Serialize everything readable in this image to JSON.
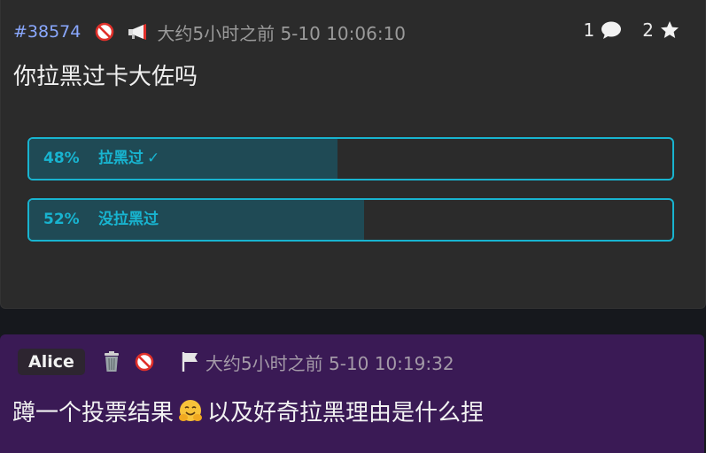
{
  "post": {
    "id": "#38574",
    "timestamp": "大约5小时之前 5-10 10:06:10",
    "comment_count": "1",
    "star_count": "2",
    "title": "你拉黑过卡大佐吗",
    "poll": [
      {
        "percent_label": "48%",
        "label": "拉黑过",
        "check": "✓",
        "fraction": 0.48
      },
      {
        "percent_label": "52%",
        "label": "没拉黑过",
        "check": "",
        "fraction": 0.52
      }
    ]
  },
  "reply": {
    "author": "Alice",
    "timestamp": "大约5小时之前 5-10 10:19:32",
    "text_before": "蹲一个投票结果",
    "text_after": "以及好奇拉黑理由是什么捏"
  },
  "colors": {
    "accent": "#18b4d0",
    "post_bg": "#2b2b2b",
    "reply_bg": "#3a1a55",
    "id_color": "#8aa8ff"
  },
  "icons": [
    "ban-icon",
    "megaphone-icon",
    "comment-icon",
    "star-icon",
    "trash-icon",
    "flag-icon",
    "hug-emoji-icon"
  ]
}
